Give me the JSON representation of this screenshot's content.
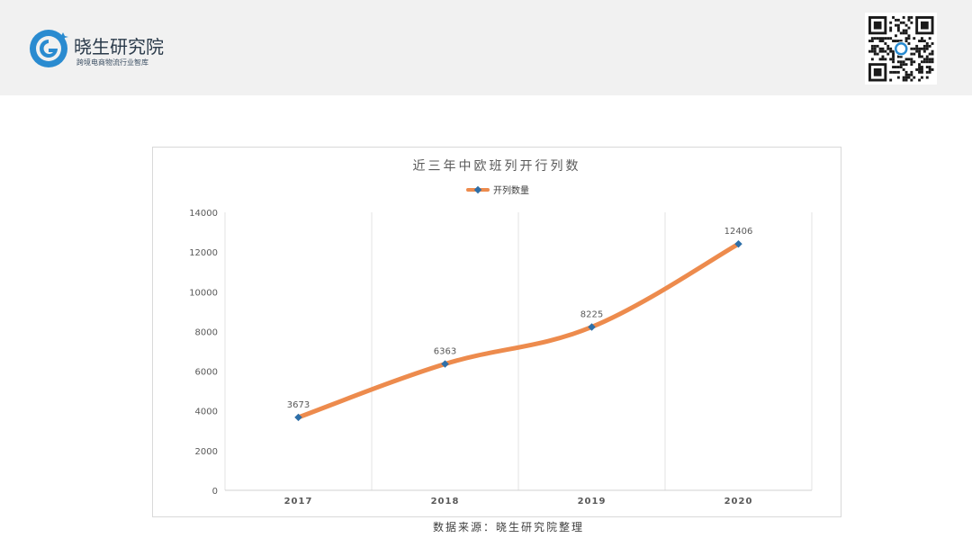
{
  "header": {
    "brand_title": "晓生研究院",
    "brand_subtitle": "跨境电商物流行业智库",
    "logo_icon": "g-logo-icon",
    "qr_icon": "qr-code-icon"
  },
  "chart_data": {
    "type": "line",
    "title": "近三年中欧班列开行列数",
    "categories": [
      "2017",
      "2018",
      "2019",
      "2020"
    ],
    "series": [
      {
        "name": "开列数量",
        "values": [
          3673,
          6363,
          8225,
          12406
        ],
        "color": "#ed8b4d",
        "marker_color": "#2e6fa8"
      }
    ],
    "ylim": [
      0,
      14000
    ],
    "yticks": [
      "0",
      "2000",
      "4000",
      "6000",
      "8000",
      "10000",
      "12000",
      "14000"
    ],
    "data_labels": [
      "3673",
      "6363",
      "8225",
      "12406"
    ],
    "xlabel": "",
    "ylabel": "",
    "legend": "top-center",
    "grid": "vertical",
    "smooth": true
  },
  "footer": {
    "source": "数据来源：晓生研究院整理"
  }
}
